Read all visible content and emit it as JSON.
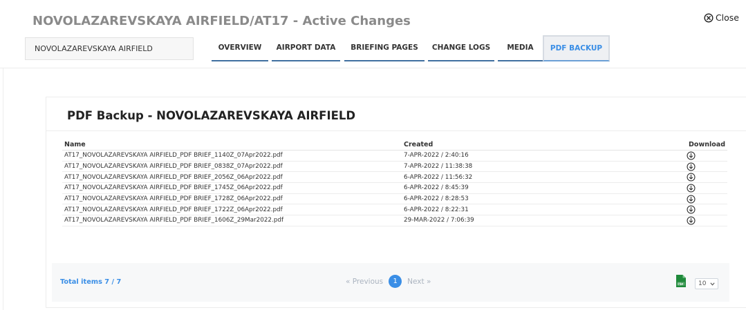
{
  "header": {
    "title": "NOVOLAZAREVSKAYA AIRFIELD/AT17 - Active Changes",
    "close_label": "Close"
  },
  "airfield_selector": {
    "value": "NOVOLAZAREVSKAYA AIRFIELD"
  },
  "tabs": [
    {
      "label": "OVERVIEW",
      "active": false
    },
    {
      "label": "AIRPORT DATA",
      "active": false
    },
    {
      "label": "BRIEFING PAGES",
      "active": false
    },
    {
      "label": "CHANGE LOGS",
      "active": false
    },
    {
      "label": "MEDIA",
      "active": false
    },
    {
      "label": "PDF BACKUP",
      "active": true
    }
  ],
  "panel": {
    "title": "PDF Backup - NOVOLAZAREVSKAYA AIRFIELD",
    "columns": {
      "name": "Name",
      "created": "Created",
      "download": "Download"
    },
    "rows": [
      {
        "name": "AT17_NOVOLAZAREVSKAYA AIRFIELD_PDF BRIEF_1140Z_07Apr2022.pdf",
        "created": "7-APR-2022 / 2:40:16",
        "download_icon": "download-circle-icon"
      },
      {
        "name": "AT17_NOVOLAZAREVSKAYA AIRFIELD_PDF BRIEF_0838Z_07Apr2022.pdf",
        "created": "7-APR-2022 / 11:38:38",
        "download_icon": "download-circle-icon"
      },
      {
        "name": "AT17_NOVOLAZAREVSKAYA AIRFIELD_PDF BRIEF_2056Z_06Apr2022.pdf",
        "created": "6-APR-2022 / 11:56:32",
        "download_icon": "download-circle-icon"
      },
      {
        "name": "AT17_NOVOLAZAREVSKAYA AIRFIELD_PDF BRIEF_1745Z_06Apr2022.pdf",
        "created": "6-APR-2022 / 8:45:39",
        "download_icon": "download-circle-icon"
      },
      {
        "name": "AT17_NOVOLAZAREVSKAYA AIRFIELD_PDF BRIEF_1728Z_06Apr2022.pdf",
        "created": "6-APR-2022 / 8:28:53",
        "download_icon": "download-circle-icon"
      },
      {
        "name": "AT17_NOVOLAZAREVSKAYA AIRFIELD_PDF BRIEF_1722Z_06Apr2022.pdf",
        "created": "6-APR-2022 / 8:22:31",
        "download_icon": "download-circle-icon"
      },
      {
        "name": "AT17_NOVOLAZAREVSKAYA AIRFIELD_PDF BRIEF_1606Z_29Mar2022.pdf",
        "created": "29-MAR-2022 / 7:06:39",
        "download_icon": "download-circle-icon"
      }
    ]
  },
  "footer": {
    "total_label": "Total items 7 / 7",
    "pagination": {
      "previous": "« Previous",
      "current_page": "1",
      "next": "Next »"
    },
    "export_icon": "csv-file-icon",
    "page_size": "10"
  },
  "colors": {
    "accent_blue": "#3a8ee6",
    "tab_underline": "#3f6fa0",
    "csv_green": "#1f8a3b",
    "title_gray": "#8a8a8a"
  }
}
